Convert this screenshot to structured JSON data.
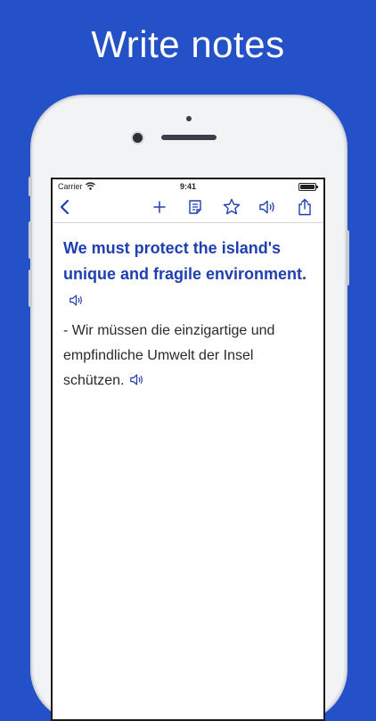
{
  "headline": "Write notes",
  "status_bar": {
    "carrier": "Carrier",
    "time": "9:41"
  },
  "toolbar": {
    "icons": [
      "chevron-left-icon",
      "plus-icon",
      "note-icon",
      "star-icon",
      "speaker-icon",
      "share-icon"
    ]
  },
  "phrase": {
    "english": "We must protect the island's unique and fragile environment.",
    "german": "- Wir müssen die einzigartige und empfindliche Umwelt der Insel schützen."
  },
  "colors": {
    "background": "#2551c8",
    "accent": "#1f3fb0",
    "phrase_text": "#1f3fb0",
    "translation_text": "#2a2a2a"
  }
}
